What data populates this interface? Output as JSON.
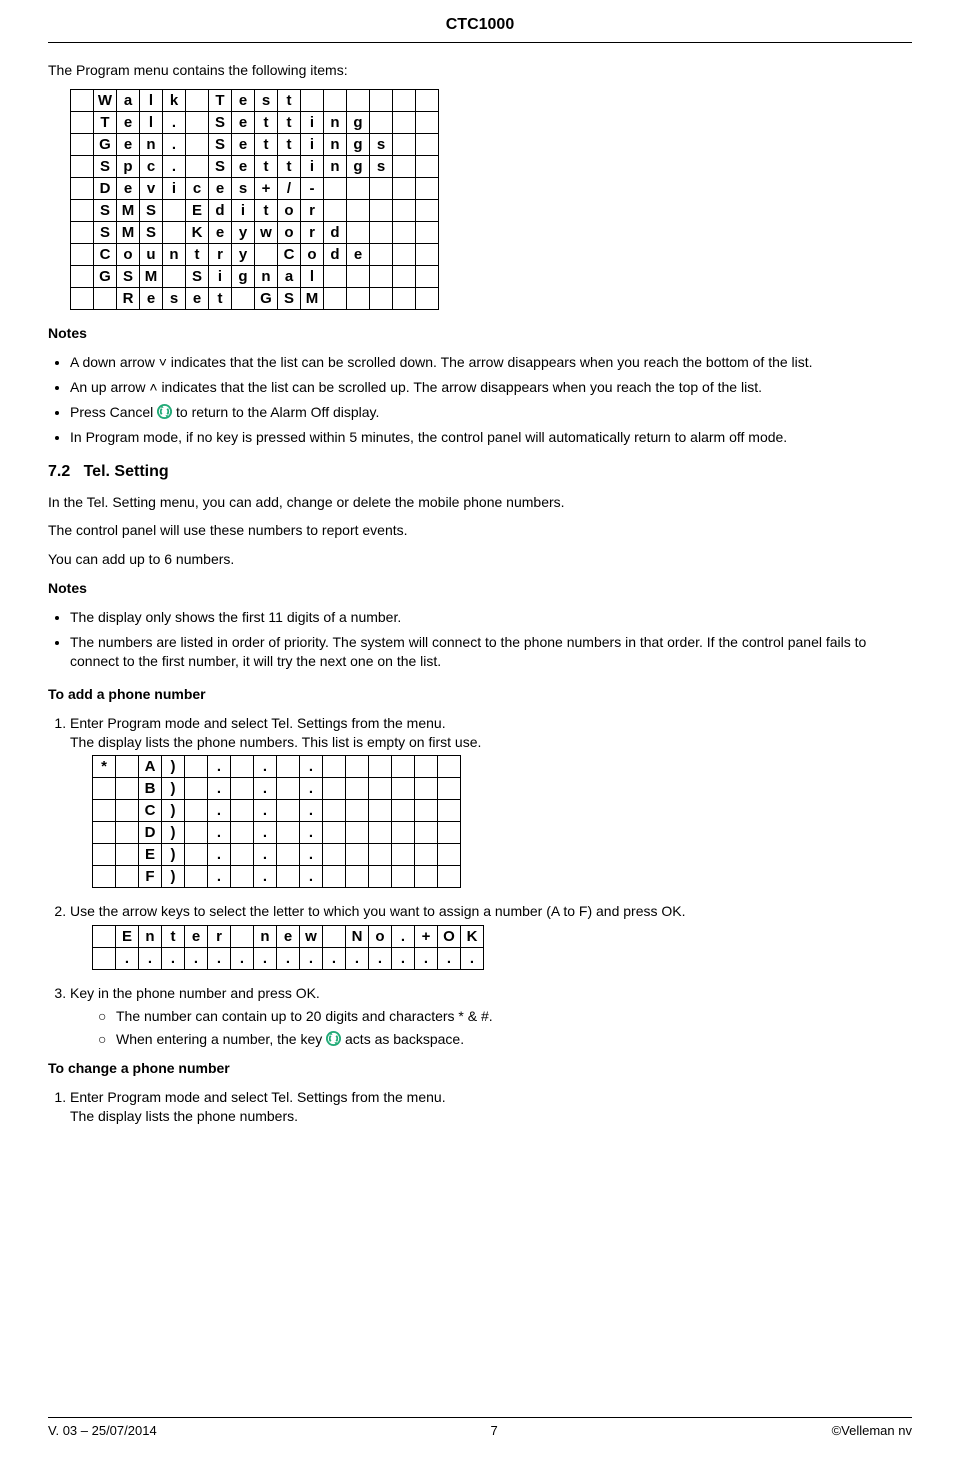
{
  "header": "CTC1000",
  "intro": "The Program menu contains the following items:",
  "lcd_menu": [
    [
      "",
      "W",
      "a",
      "l",
      "k",
      "",
      "T",
      "e",
      "s",
      "t",
      "",
      "",
      "",
      "",
      "",
      ""
    ],
    [
      "",
      "T",
      "e",
      "l",
      ".",
      "",
      "S",
      "e",
      "t",
      "t",
      "i",
      "n",
      "g",
      "",
      "",
      ""
    ],
    [
      "",
      "G",
      "e",
      "n",
      ".",
      "",
      "S",
      "e",
      "t",
      "t",
      "i",
      "n",
      "g",
      "s",
      "",
      ""
    ],
    [
      "",
      "S",
      "p",
      "c",
      ".",
      "",
      "S",
      "e",
      "t",
      "t",
      "i",
      "n",
      "g",
      "s",
      "",
      ""
    ],
    [
      "",
      "D",
      "e",
      "v",
      "i",
      "c",
      "e",
      "s",
      "+",
      "/",
      "-",
      "",
      "",
      "",
      "",
      ""
    ],
    [
      "",
      "S",
      "M",
      "S",
      "",
      "E",
      "d",
      "i",
      "t",
      "o",
      "r",
      "",
      "",
      "",
      "",
      ""
    ],
    [
      "",
      "S",
      "M",
      "S",
      "",
      "K",
      "e",
      "y",
      "w",
      "o",
      "r",
      "d",
      "",
      "",
      "",
      ""
    ],
    [
      "",
      "C",
      "o",
      "u",
      "n",
      "t",
      "r",
      "y",
      "",
      "C",
      "o",
      "d",
      "e",
      "",
      "",
      ""
    ],
    [
      "",
      "G",
      "S",
      "M",
      "",
      "S",
      "i",
      "g",
      "n",
      "a",
      "l",
      "",
      "",
      "",
      "",
      ""
    ],
    [
      "",
      "",
      "R",
      "e",
      "s",
      "e",
      "t",
      "",
      "G",
      "S",
      "M",
      "",
      "",
      "",
      "",
      ""
    ]
  ],
  "notes1_label": "Notes",
  "notes1": [
    "A down arrow ˅ indicates that the list can be scrolled down. The arrow disappears when you reach the bottom of the list.",
    "An up arrow ˄ indicates that the list can be scrolled up. The arrow disappears when you reach the top of the list.",
    {
      "pre": "Press Cancel ",
      "post": " to return to the Alarm Off display."
    },
    "In Program mode, if no key is pressed within 5 minutes, the control panel will automatically return to alarm off mode."
  ],
  "section": {
    "num": "7.2",
    "title": "Tel. Setting"
  },
  "tel_p1": "In the Tel. Setting menu, you can add, change or delete the mobile phone numbers.",
  "tel_p2": "The control panel will use these numbers to report events.",
  "tel_p3": "You can add up to 6 numbers.",
  "notes2_label": "Notes",
  "notes2": [
    "The display only shows the first 11 digits of a number.",
    "The numbers are listed in order of priority. The system will connect to the phone numbers in that order. If the control panel fails to connect to the first number, it will try the next one on the list."
  ],
  "add_title": "To add a phone number",
  "add_step1a": "Enter Program mode and select Tel. Settings from the menu.",
  "add_step1b": "The display lists the phone numbers. This list is empty on first use.",
  "lcd_phone": [
    [
      "*",
      "",
      "A",
      ")",
      "",
      ".",
      "",
      ".",
      "",
      ".",
      "",
      "",
      "",
      "",
      "",
      ""
    ],
    [
      "",
      "",
      "B",
      ")",
      "",
      ".",
      "",
      ".",
      "",
      ".",
      "",
      "",
      "",
      "",
      "",
      ""
    ],
    [
      "",
      "",
      "C",
      ")",
      "",
      ".",
      "",
      ".",
      "",
      ".",
      "",
      "",
      "",
      "",
      "",
      ""
    ],
    [
      "",
      "",
      "D",
      ")",
      "",
      ".",
      "",
      ".",
      "",
      ".",
      "",
      "",
      "",
      "",
      "",
      ""
    ],
    [
      "",
      "",
      "E",
      ")",
      "",
      ".",
      "",
      ".",
      "",
      ".",
      "",
      "",
      "",
      "",
      "",
      ""
    ],
    [
      "",
      "",
      "F",
      ")",
      "",
      ".",
      "",
      ".",
      "",
      ".",
      "",
      "",
      "",
      "",
      "",
      ""
    ]
  ],
  "add_step2": "Use the arrow keys to select the letter to which you want to assign a number (A to F) and press OK.",
  "lcd_enter": [
    [
      "",
      "E",
      "n",
      "t",
      "e",
      "r",
      "",
      "n",
      "e",
      "w",
      "",
      "N",
      "o",
      ".",
      "+",
      "O",
      "K"
    ],
    [
      "",
      ".",
      ".",
      ".",
      ".",
      ".",
      ".",
      ".",
      ".",
      ".",
      ".",
      ".",
      ".",
      ".",
      ".",
      ".",
      "."
    ]
  ],
  "add_step3": "Key in the phone number and press OK.",
  "add_step3_sub1": "The number can contain up to 20 digits and characters * & #.",
  "add_step3_sub2_pre": "When entering a number, the key ",
  "add_step3_sub2_post": " acts as backspace.",
  "change_title": "To change a phone number",
  "change_step1a": "Enter Program mode and select Tel. Settings from the menu.",
  "change_step1b": "The display lists the phone numbers.",
  "footer": {
    "left": "V. 03 – 25/07/2014",
    "center": "7",
    "right": "©Velleman nv"
  }
}
